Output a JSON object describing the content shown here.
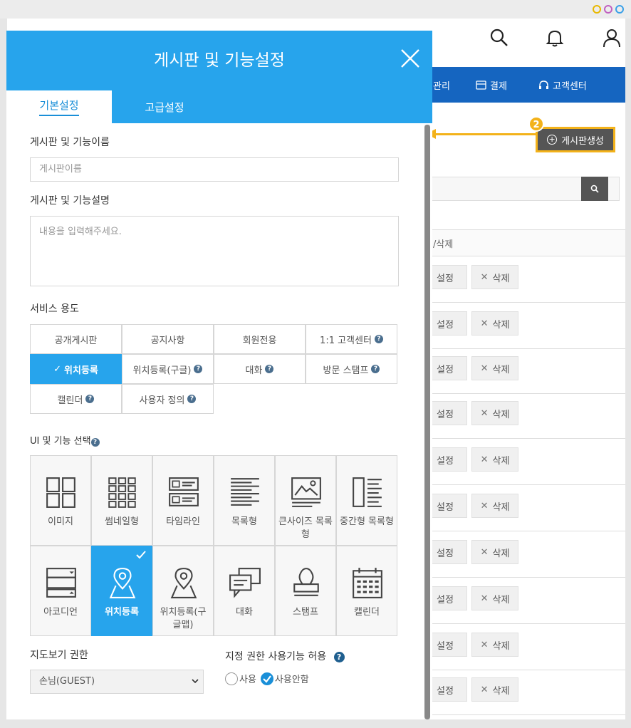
{
  "background_app": {
    "nav": {
      "items": [
        {
          "label": "관리",
          "icon": "none"
        },
        {
          "label": "결제",
          "icon": "card-icon"
        },
        {
          "label": "고객센터",
          "icon": "headset-icon"
        }
      ]
    },
    "create_button_label": "게시판생성",
    "step_number": "2",
    "table": {
      "column_header": "/삭제",
      "rows": [
        {
          "edit": "설정",
          "delete": "삭제"
        },
        {
          "edit": "설정",
          "delete": "삭제"
        },
        {
          "edit": "설정",
          "delete": "삭제"
        },
        {
          "edit": "설정",
          "delete": "삭제"
        },
        {
          "edit": "설정",
          "delete": "삭제"
        },
        {
          "edit": "설정",
          "delete": "삭제"
        },
        {
          "edit": "설정",
          "delete": "삭제"
        },
        {
          "edit": "설정",
          "delete": "삭제"
        },
        {
          "edit": "설정",
          "delete": "삭제"
        },
        {
          "edit": "설정",
          "delete": "삭제"
        }
      ]
    },
    "accent_color": "#1565c0",
    "highlight_color": "#f3b21a"
  },
  "modal": {
    "title": "게시판 및 기능설정",
    "tabs": [
      {
        "label": "기본설정",
        "active": true
      },
      {
        "label": "고급설정",
        "active": false
      }
    ],
    "name_label": "게시판 및 기능이름",
    "name_placeholder": "게시판이름",
    "desc_label": "게시판 및 기능설명",
    "desc_placeholder": "내용을 입력해주세요.",
    "service_label": "서비스 용도",
    "services": [
      {
        "label": "공개게시판",
        "help": false,
        "selected": false
      },
      {
        "label": "공지사항",
        "help": false,
        "selected": false
      },
      {
        "label": "회원전용",
        "help": false,
        "selected": false
      },
      {
        "label": "1:1 고객센터",
        "help": true,
        "selected": false
      },
      {
        "label": "위치등록",
        "help": false,
        "selected": true
      },
      {
        "label": "위치등록(구글)",
        "help": true,
        "selected": false
      },
      {
        "label": "대화",
        "help": true,
        "selected": false
      },
      {
        "label": "방문 스탬프",
        "help": true,
        "selected": false
      },
      {
        "label": "캘린더",
        "help": true,
        "selected": false
      },
      {
        "label": "사용자 정의",
        "help": true,
        "selected": false
      }
    ],
    "ui_label": "UI 및 기능 선택",
    "ui_options": [
      {
        "label": "이미지",
        "icon": "image-layout-icon",
        "selected": false
      },
      {
        "label": "썸네일형",
        "icon": "thumbnail-grid-icon",
        "selected": false
      },
      {
        "label": "타임라인",
        "icon": "timeline-icon",
        "selected": false
      },
      {
        "label": "목록형",
        "icon": "list-icon",
        "selected": false
      },
      {
        "label": "큰사이즈 목록형",
        "icon": "large-list-icon",
        "selected": false
      },
      {
        "label": "중간형 목록형",
        "icon": "medium-list-icon",
        "selected": false
      },
      {
        "label": "아코디언",
        "icon": "accordion-icon",
        "selected": false
      },
      {
        "label": "위치등록",
        "icon": "map-pin-icon",
        "selected": true
      },
      {
        "label": "위치등록(구글맵)",
        "icon": "map-pin-google-icon",
        "selected": false
      },
      {
        "label": "대화",
        "icon": "chat-icon",
        "selected": false
      },
      {
        "label": "스탬프",
        "icon": "stamp-icon",
        "selected": false
      },
      {
        "label": "캘린더",
        "icon": "calendar-icon",
        "selected": false
      }
    ],
    "map_perm_label": "지도보기 권한",
    "map_perm_value": "손님(GUEST)",
    "allow_label": "지정 권한 사용기능 허용",
    "allow_options": [
      {
        "label": "사용",
        "checked": false
      },
      {
        "label": "사용안함",
        "checked": true
      }
    ],
    "accent_color": "#27a4ec"
  }
}
